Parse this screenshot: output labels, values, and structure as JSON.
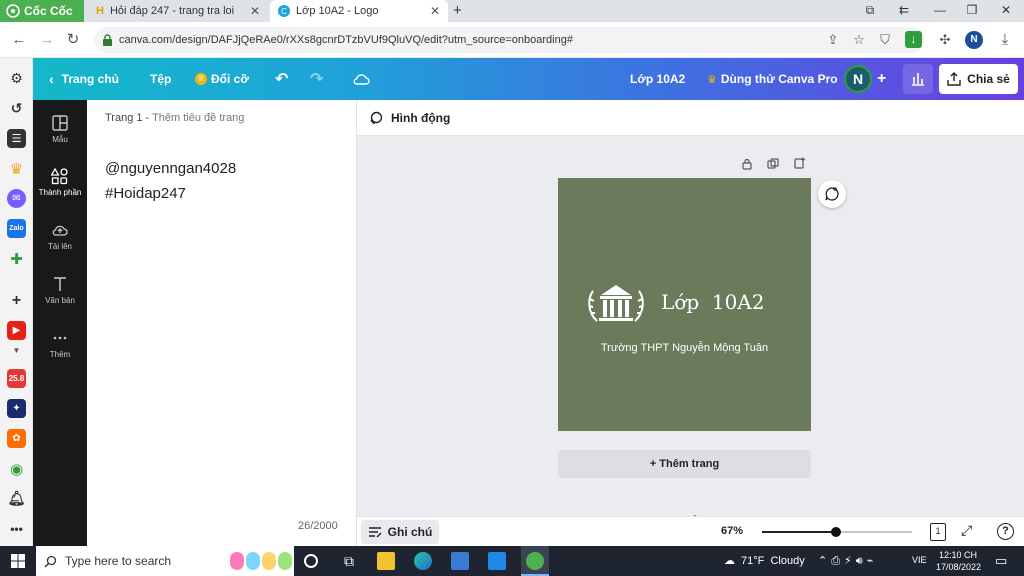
{
  "browser": {
    "brand": "Cốc Cốc",
    "tabs": [
      {
        "title": "Hỏi đáp 247 - trang tra loi"
      },
      {
        "title": "Lớp 10A2 - Logo"
      }
    ],
    "url": "canva.com/design/DAFJjQeRAe0/rXXs8gcnrDTzbVUf9QluVQ/edit?utm_source=onboarding#",
    "profile_initial": "N"
  },
  "canva": {
    "home": "Trang chủ",
    "file": "Tệp",
    "resize": "Đổi cỡ",
    "doc_title": "Lớp 10A2",
    "try_pro": "Dùng thử Canva Pro",
    "avatar": "N",
    "share": "Chia sẻ",
    "rail": [
      {
        "label": "Mẫu"
      },
      {
        "label": "Thành phần"
      },
      {
        "label": "Tải lên"
      },
      {
        "label": "Văn bản"
      },
      {
        "label": "Thêm"
      }
    ],
    "page_label": "Trang 1 - ",
    "page_title_placeholder": "Thêm tiêu đề trang",
    "notes_lines": [
      "@nguyenngan4028",
      "#Hoidap247"
    ],
    "char_count": "26/2000",
    "animation": "Hình động",
    "design_title": "Lớp  10A2",
    "design_subtitle": "Trường THPT Nguyễn Mộng Tuân",
    "add_page": "+ Thêm trang",
    "notes_button": "Ghi chú",
    "zoom": "67%",
    "zoom_level": 0.49,
    "page_number": "1",
    "help": "?"
  },
  "taskbar": {
    "search_placeholder": "Type here to search",
    "weather": "71°F  Cloudy",
    "lang": "VIE",
    "time": "12:10 CH",
    "date": "17/08/2022"
  },
  "colors": {
    "design_bg": "#6c7a5c",
    "rail_bg": "#18191b",
    "brand_green": "#4caf50"
  }
}
